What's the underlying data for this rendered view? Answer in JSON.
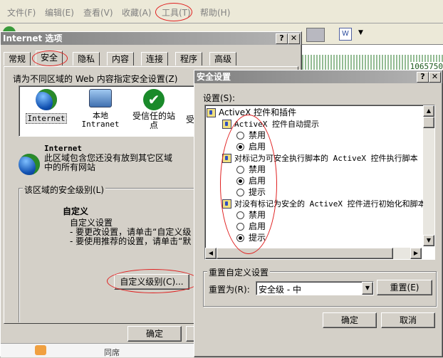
{
  "menubar": {
    "file": "文件(F)",
    "edit": "编辑(E)",
    "view": "查看(V)",
    "favorites": "收藏(A)",
    "tools": "工具(T)",
    "help": "帮助(H)"
  },
  "browser": {
    "counter_text": "1065750"
  },
  "internet_options": {
    "title": "Internet 选项",
    "tabs": [
      "常规",
      "安全",
      "隐私",
      "内容",
      "连接",
      "程序",
      "高级"
    ],
    "zone_prompt": "请为不同区域的 Web 内容指定安全设置(Z)",
    "zones": [
      {
        "label": "Internet",
        "icon": "globe-icon"
      },
      {
        "label": "本地\nIntranet",
        "icon": "computer-icon"
      },
      {
        "label": "受信任的站\n点",
        "icon": "checkmark-icon"
      },
      {
        "label": "受",
        "icon": "restricted-icon"
      }
    ],
    "zone_title": "Internet",
    "zone_desc": "此区域包含您还没有放到其它区域\n中的所有网站",
    "security_level_group": "该区域的安全级别(L)",
    "custom_title": "自定义",
    "custom_line1": "自定义设置",
    "custom_line2": "- 要更改设置，请单击“自定义级",
    "custom_line3": "- 要使用推荐的设置，请单击“默",
    "custom_level_button": "自定义级别(C)...",
    "ok_button": "确定",
    "bottom_partial_text": "同席"
  },
  "security_settings": {
    "title": "安全设置",
    "settings_label": "设置(S):",
    "tree": [
      {
        "type": "category",
        "label": "ActiveX 控件和插件",
        "indent": 0
      },
      {
        "type": "category",
        "label": "ActiveX 控件自动提示",
        "indent": 1
      },
      {
        "type": "radio",
        "label": "禁用",
        "checked": false
      },
      {
        "type": "radio",
        "label": "启用",
        "checked": true
      },
      {
        "type": "category",
        "label": "对标记为可安全执行脚本的 ActiveX 控件执行脚本",
        "indent": 1
      },
      {
        "type": "radio",
        "label": "禁用",
        "checked": false
      },
      {
        "type": "radio",
        "label": "启用",
        "checked": true
      },
      {
        "type": "radio",
        "label": "提示",
        "checked": false
      },
      {
        "type": "category",
        "label": "对没有标记为安全的 ActiveX 控件进行初始化和脚本",
        "indent": 1
      },
      {
        "type": "radio",
        "label": "禁用",
        "checked": false
      },
      {
        "type": "radio",
        "label": "启用",
        "checked": false
      },
      {
        "type": "radio",
        "label": "提示",
        "checked": true
      }
    ],
    "reset_group": "重置自定义设置",
    "reset_to_label": "重置为(R):",
    "reset_value": "安全级 - 中",
    "reset_button": "重置(E)",
    "ok_button": "确定",
    "cancel_button": "取消"
  },
  "colors": {
    "annotation_red": "#e02020",
    "title_inactive": "#808080",
    "dialog_face": "#d4d0c8"
  }
}
